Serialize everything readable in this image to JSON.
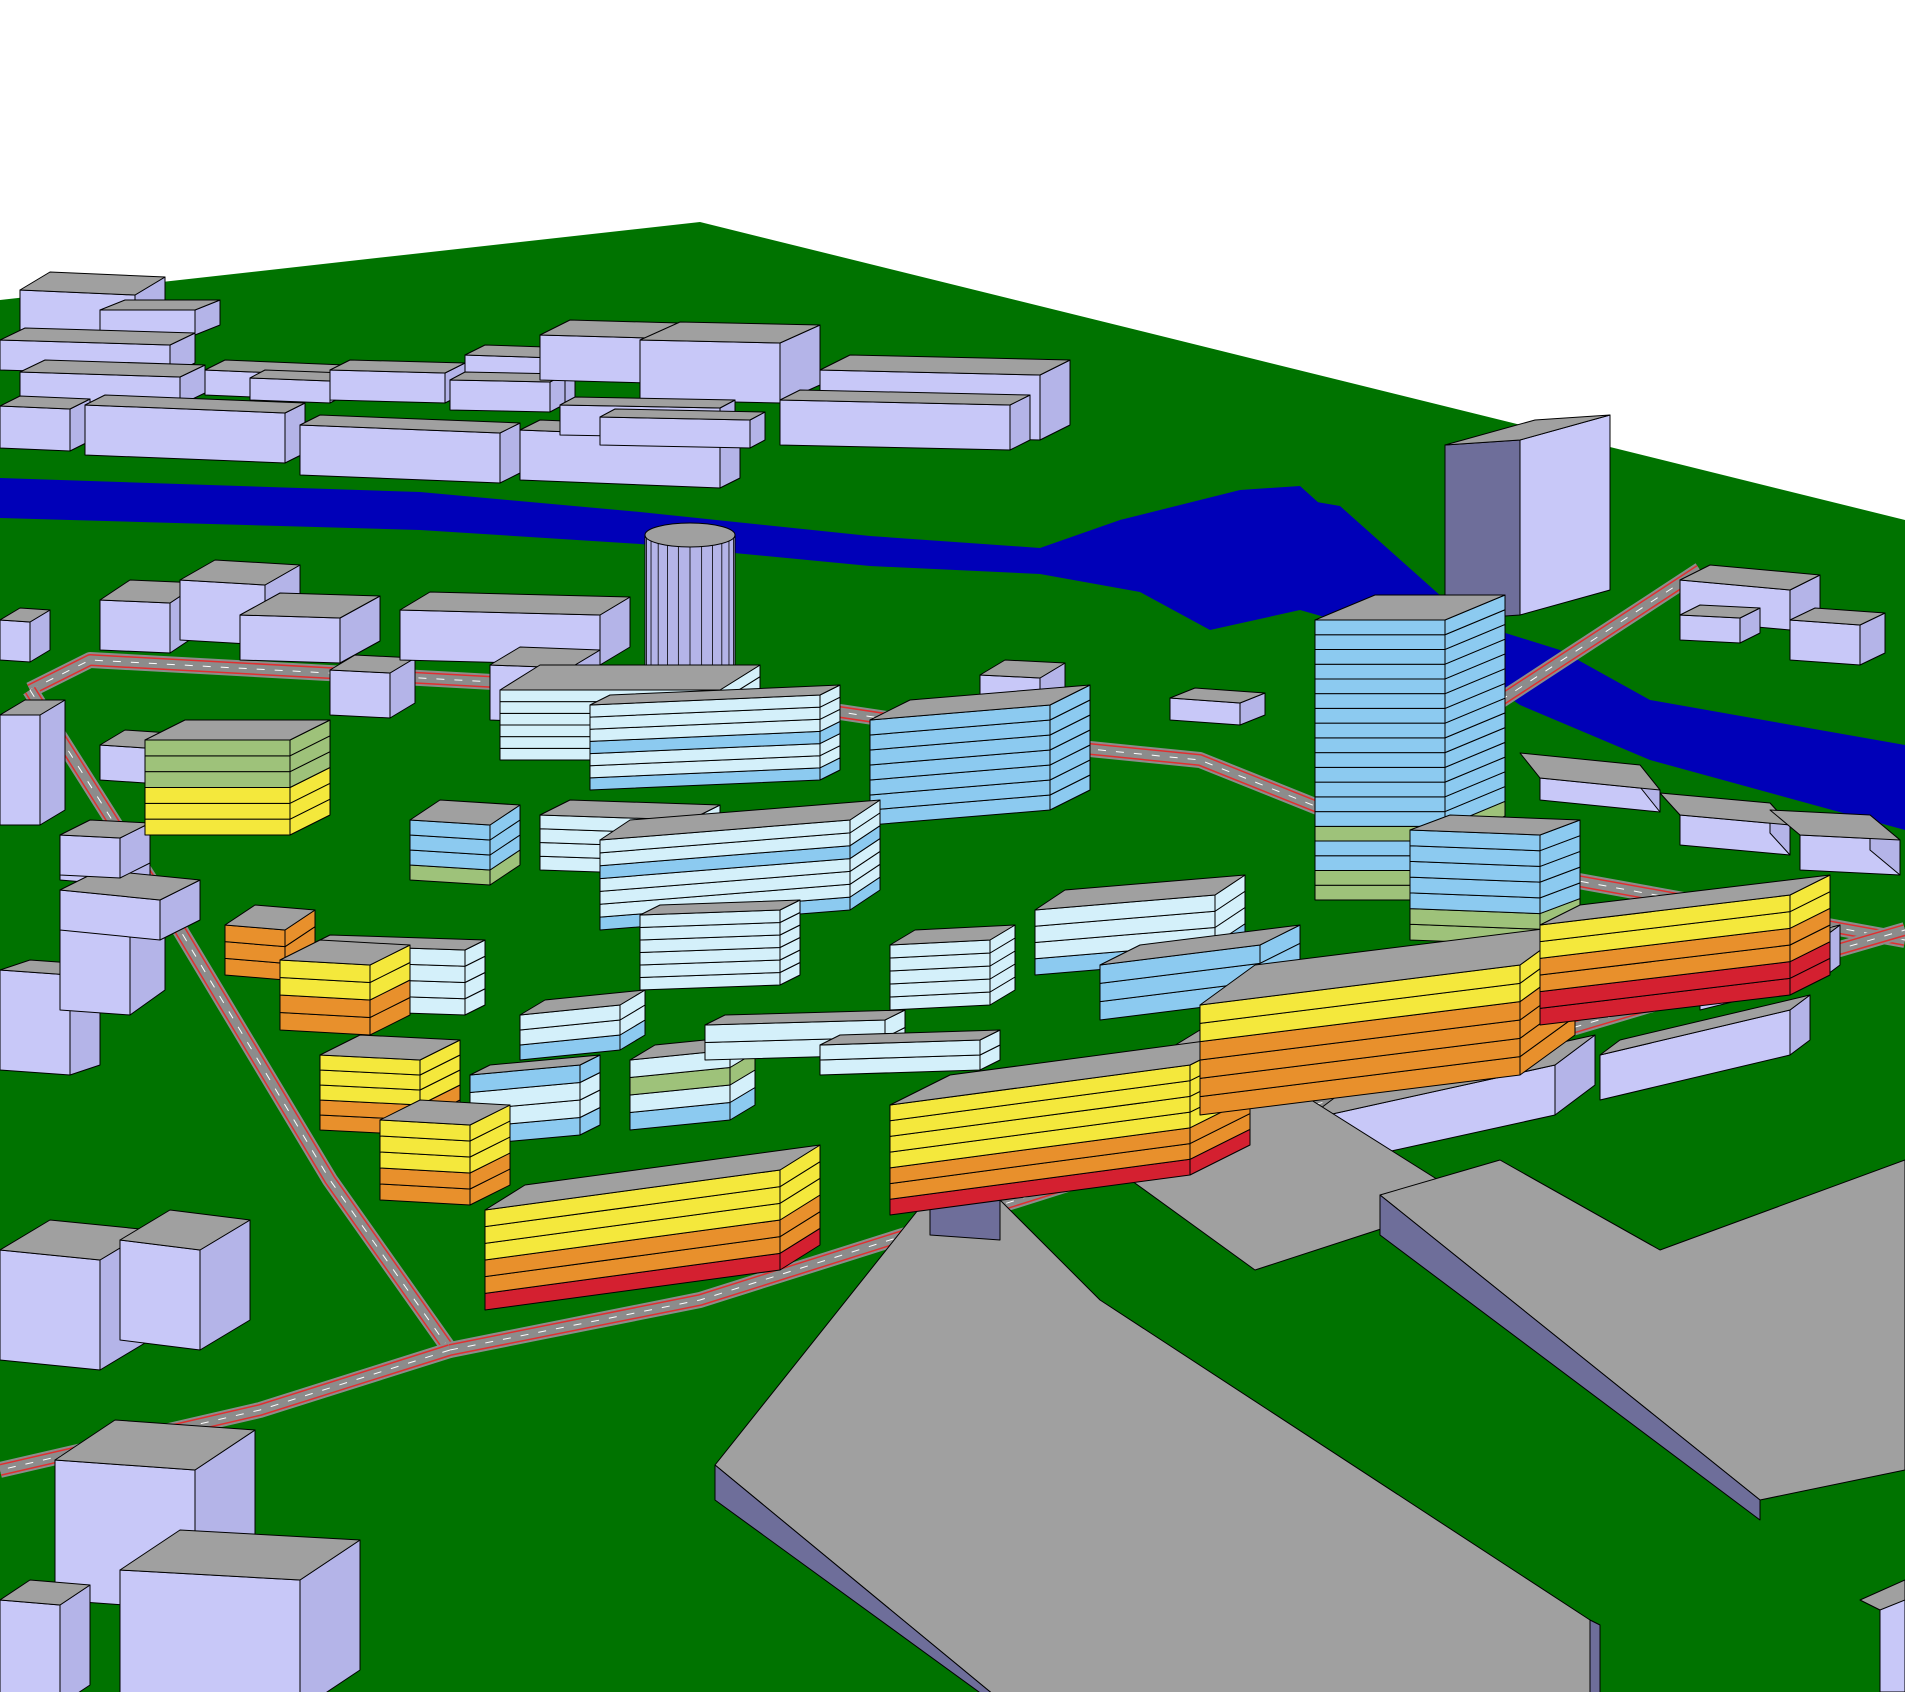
{
  "scene": {
    "colors": {
      "sky": "#ffffff",
      "ground": "#007300",
      "water": "#0000b8",
      "road": "#8c8c8c",
      "road_stripe": "#e03030",
      "roof": "#a0a0a0",
      "context_face_light": "#c8c8f8",
      "context_face_mid": "#b4b4e8",
      "context_face_dark": "#6e6e9a",
      "noise_red": "#d42030",
      "noise_orange": "#e8902c",
      "noise_yellow": "#f4e83c",
      "noise_green": "#9ec27a",
      "noise_lightblue": "#8ccaf0",
      "noise_paleblue": "#d4f0fa",
      "outline": "#000000"
    }
  }
}
